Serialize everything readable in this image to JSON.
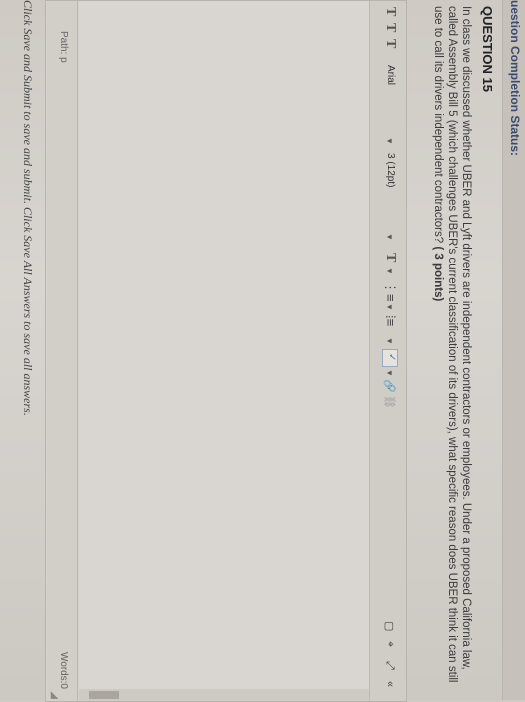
{
  "status": {
    "label": "uestion Completion Status:"
  },
  "question": {
    "title": "QUESTION 15",
    "text": "In class we discussed whether UBER and Lyft drivers are independent contractors or employees. Under a proposed California law, called Assembly Bill 5 (which challenges UBER's current classification of its drivers), what specific reason does UBER think it can still use to call its drivers independent contractors?",
    "points": "( 3 points)"
  },
  "toolbar": {
    "t1": "T",
    "t2": "T",
    "t3": "T",
    "font_family": "Arial",
    "font_size": "3 (12pt)",
    "text_color_label": "T",
    "list_unordered": "⋮≡",
    "list_ordered": "⁞≡",
    "spell_icon": "✓",
    "link_icon": "🔗",
    "unlink_icon": "⛓",
    "right_icons": [
      "▢",
      "⌖",
      "⤢",
      "«"
    ]
  },
  "editor": {
    "path_label": "Path: p",
    "words_label": "Words:0"
  },
  "footer_instructions": "Click Save and Submit to save and submit. Click Save All Answers to save all answers."
}
